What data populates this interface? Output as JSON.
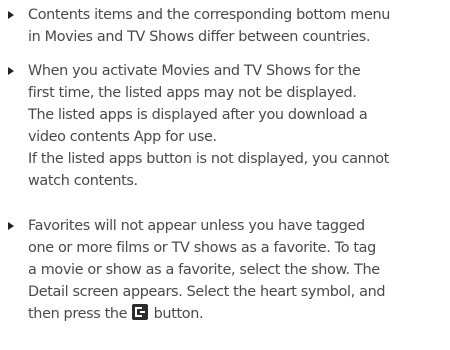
{
  "notes": [
    {
      "lines": [
        "Contents items and the corresponding bottom menu",
        "in Movies and TV Shows differ between countries."
      ]
    },
    {
      "lines": [
        "When you activate Movies and TV Shows for the",
        "first time, the listed apps may not be displayed.",
        "The listed apps is displayed after you download a",
        "video contents App for use.",
        "If the listed apps button is not displayed, you cannot",
        "watch contents."
      ]
    },
    {
      "lines": [
        "Favorites will not appear unless you have tagged",
        "one or more  films or TV shows as a favorite. To tag",
        "a movie or show as a favorite, select the show. The",
        "Detail screen appears. Select the heart symbol, and"
      ],
      "last_line_before_icon": "then press the ",
      "last_line_after_icon": " button.",
      "icon": "return-key-icon"
    }
  ]
}
